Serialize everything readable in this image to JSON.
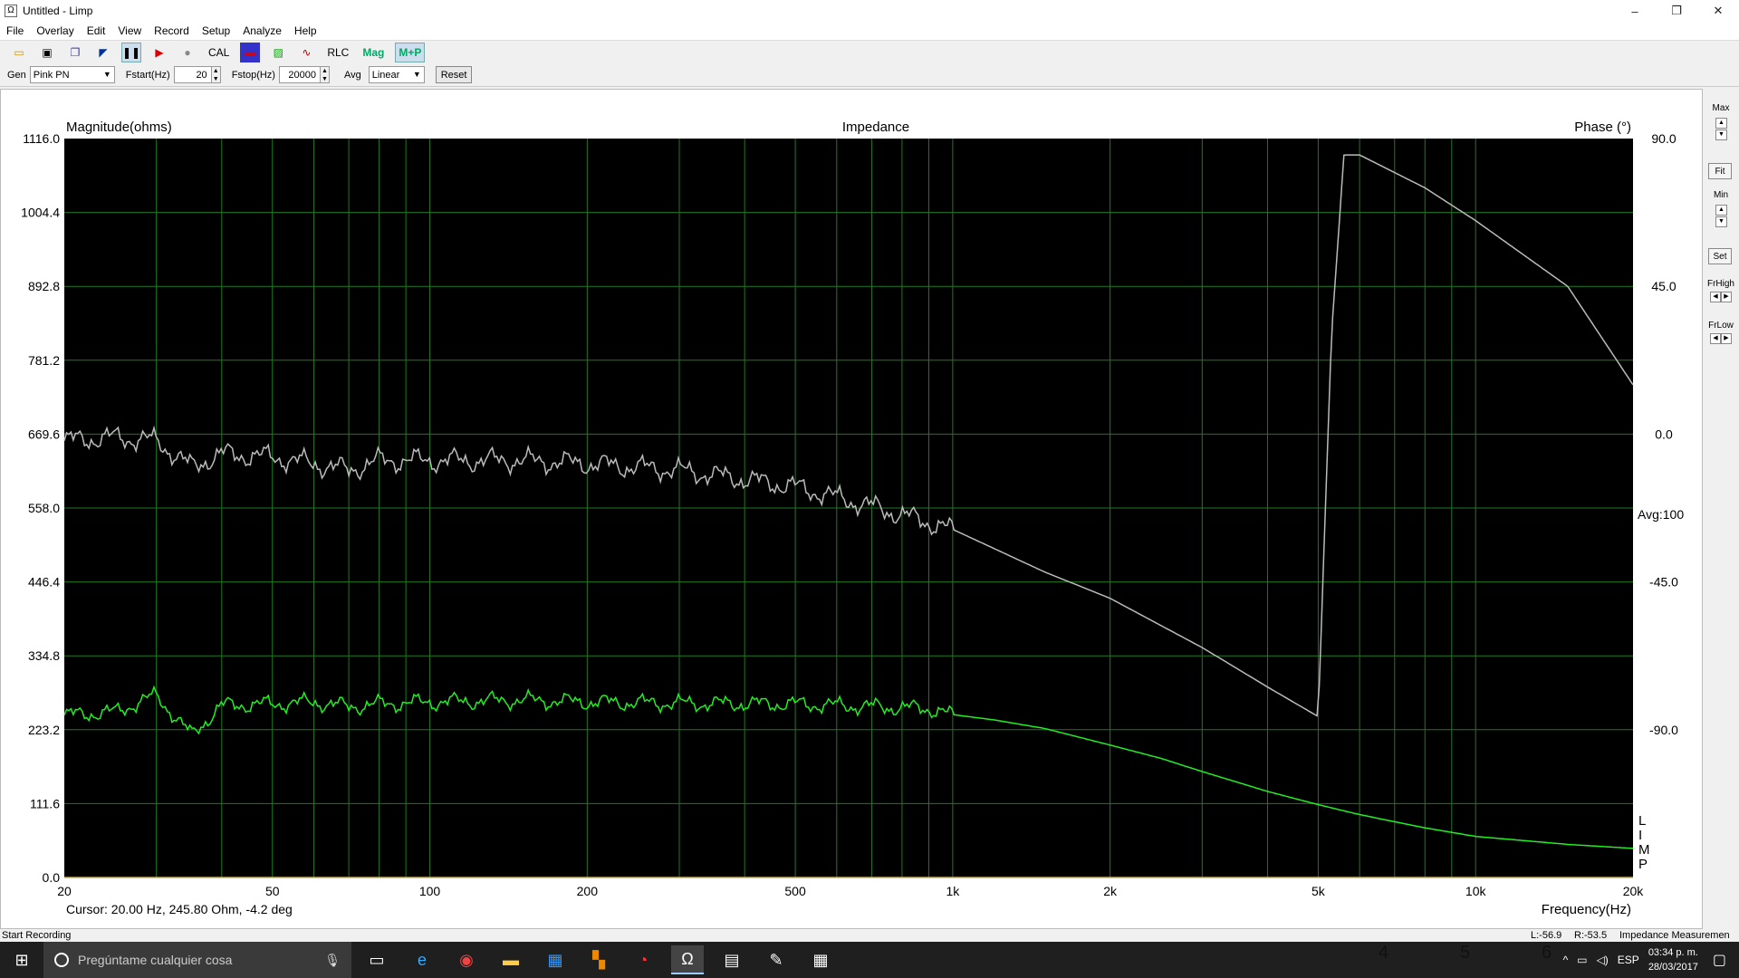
{
  "window": {
    "title": "Untitled - Limp",
    "controls": [
      "–",
      "❐",
      "✕"
    ]
  },
  "menu": [
    "File",
    "Overlay",
    "Edit",
    "View",
    "Record",
    "Setup",
    "Analyze",
    "Help"
  ],
  "toolbar": {
    "cal_label": "CAL",
    "rlc_label": "RLC",
    "mag_label": "Mag",
    "mp_label": "M+P"
  },
  "controls": {
    "gen_label": "Gen",
    "gen_value": "Pink PN",
    "fstart_label": "Fstart(Hz)",
    "fstart_value": "20",
    "fstop_label": "Fstop(Hz)",
    "fstop_value": "20000",
    "avg_label": "Avg",
    "avg_value": "Linear",
    "reset_label": "Reset"
  },
  "chart_data": {
    "type": "line",
    "title": "Impedance",
    "ylabel": "Magnitude(ohms)",
    "y2label": "Phase (°)",
    "xlabel": "Frequency(Hz)",
    "xscale": "log",
    "xlim": [
      20,
      20000
    ],
    "ylim": [
      0,
      1116
    ],
    "y2lim": [
      -135,
      90
    ],
    "x_ticks": [
      20,
      50,
      100,
      200,
      500,
      1000,
      2000,
      5000,
      10000,
      20000
    ],
    "x_tick_labels": [
      "20",
      "50",
      "100",
      "200",
      "500",
      "1k",
      "2k",
      "5k",
      "10k",
      "20k"
    ],
    "y_tick_labels": [
      "1116.0",
      "1004.4",
      "892.8",
      "781.2",
      "669.6",
      "558.0",
      "446.4",
      "334.8",
      "223.2",
      "111.6",
      "0.0"
    ],
    "y2_tick_labels": [
      "90.0",
      "45.0",
      "0.0",
      "-45.0",
      "-90.0"
    ],
    "avg_label": "Avg:100",
    "legend": [
      "L",
      "I",
      "M",
      "P"
    ],
    "grid": true,
    "background": "#000000",
    "grid_color": "#1f7a1f",
    "series": [
      {
        "name": "Magnitude",
        "color": "#22ee22",
        "x": [
          20,
          25,
          30,
          35,
          40,
          50,
          60,
          70,
          80,
          100,
          150,
          200,
          300,
          500,
          700,
          900,
          1000,
          1200,
          1500,
          2000,
          2500,
          3000,
          4000,
          5000,
          6000,
          8000,
          10000,
          15000,
          20000
        ],
        "y": [
          245,
          250,
          275,
          215,
          260,
          262,
          265,
          258,
          262,
          265,
          268,
          265,
          263,
          262,
          258,
          255,
          246,
          238,
          225,
          200,
          180,
          160,
          130,
          110,
          95,
          75,
          62,
          50,
          44
        ]
      },
      {
        "name": "Phase",
        "color": "#bbbbbb",
        "x": [
          20,
          25,
          30,
          35,
          40,
          50,
          60,
          70,
          80,
          100,
          150,
          200,
          300,
          500,
          700,
          1000,
          1500,
          2000,
          3000,
          4000,
          5000,
          5300,
          5600,
          6000,
          8000,
          10000,
          15000,
          20000
        ],
        "y": [
          -2,
          -1,
          -2,
          -10,
          -6,
          -7,
          -9,
          -11,
          -8,
          -8,
          -8,
          -9,
          -11,
          -16,
          -22,
          -29,
          -42,
          -50,
          -65,
          -77,
          -86,
          30,
          85,
          85,
          75,
          65,
          45,
          15
        ]
      }
    ]
  },
  "cursor_readout": "Cursor: 20.00 Hz, 245.80 Ohm, -4.2 deg",
  "sidebar": {
    "max_label": "Max",
    "fit_label": "Fit",
    "min_label": "Min",
    "set_label": "Set",
    "frhigh_label": "FrHigh",
    "frlow_label": "FrLow"
  },
  "status": {
    "left": "Start Recording",
    "l_value": "L:-56.9",
    "r_value": "R:-53.5",
    "mode": "Impedance Measuremen"
  },
  "taskbar": {
    "search_placeholder": "Pregúntame cualquier cosa",
    "time": "03:34 p. m.",
    "date": "28/03/2017",
    "lang": "ESP",
    "ghost_digits": [
      "4",
      "5",
      "6"
    ]
  }
}
